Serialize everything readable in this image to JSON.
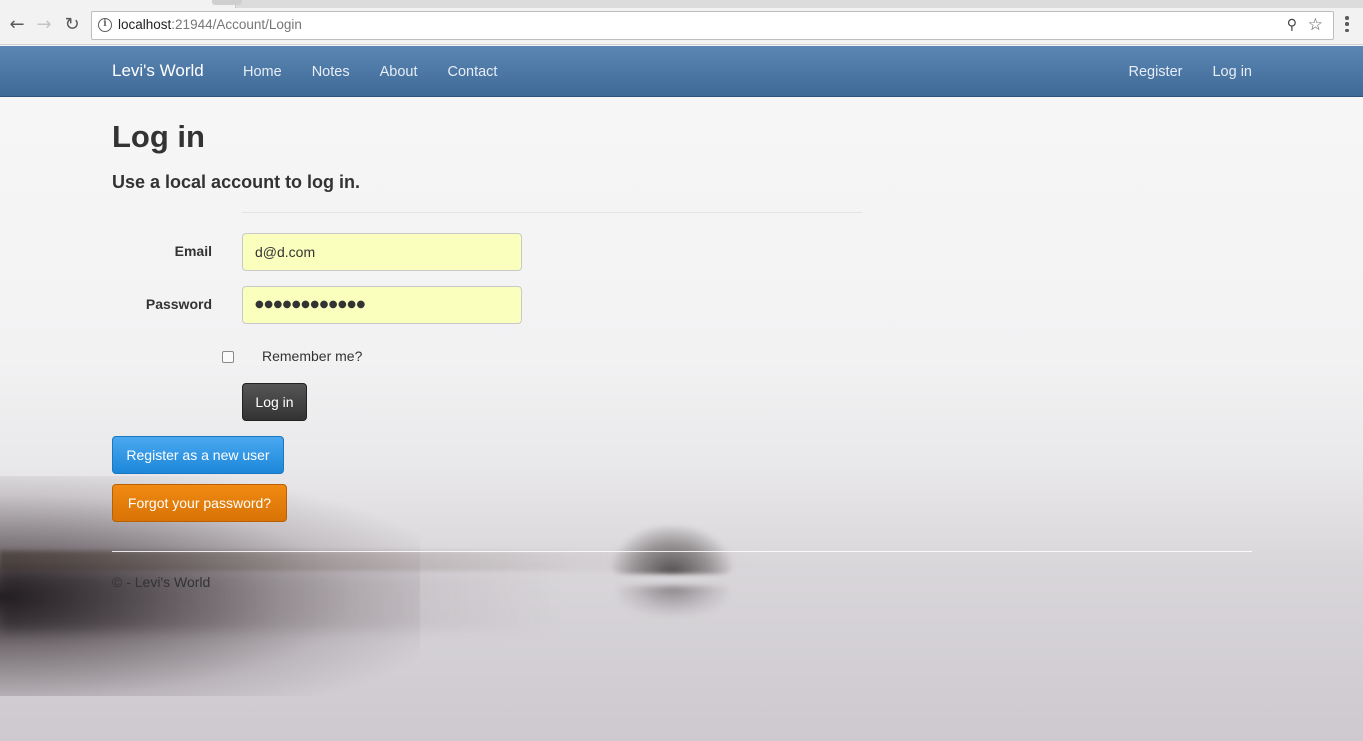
{
  "browser": {
    "url_host": "localhost",
    "url_path": ":21944/Account/Login",
    "back_icon": "arrow-left-icon",
    "forward_icon": "arrow-right-icon",
    "reload_icon": "reload-icon",
    "bookmark_icon": "star-icon",
    "key_icon": "key-icon",
    "menu_icon": "vertical-dots-icon"
  },
  "navbar": {
    "brand": "Levi's World",
    "links": [
      "Home",
      "Notes",
      "About",
      "Contact"
    ],
    "right_links": [
      "Register",
      "Log in"
    ],
    "color": "#4a76a4"
  },
  "main": {
    "title": "Log in",
    "subtitle": "Use a local account to log in.",
    "email_label": "Email",
    "email_value": "d@d.com",
    "password_label": "Password",
    "password_value": "●●●●●●●●●●●●",
    "remember_label": "Remember me?",
    "remember_checked": false,
    "login_button": "Log in",
    "register_button": "Register as a new user",
    "forgot_button": "Forgot your password?"
  },
  "footer": {
    "text": "© - Levi's World"
  },
  "colors": {
    "autofill": "#faffbd",
    "register_btn": "#2b92e2",
    "forgot_btn": "#e47d08",
    "login_btn": "#3c3c3c"
  }
}
